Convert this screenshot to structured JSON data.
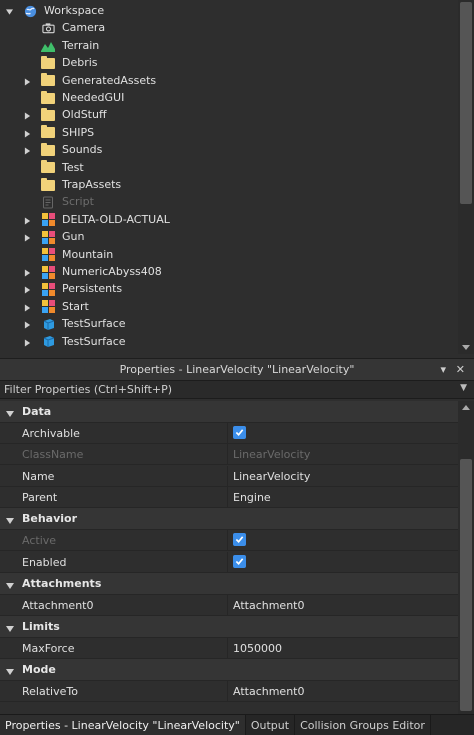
{
  "explorer": {
    "items": [
      {
        "label": "Workspace",
        "icon": "globe-icon",
        "arrow": "down",
        "level": 0,
        "dim": false
      },
      {
        "label": "Camera",
        "icon": "camera-icon",
        "arrow": "",
        "level": 1,
        "dim": false
      },
      {
        "label": "Terrain",
        "icon": "terrain-icon",
        "arrow": "",
        "level": 1,
        "dim": false
      },
      {
        "label": "Debris",
        "icon": "folder-icon",
        "arrow": "",
        "level": 1,
        "dim": false
      },
      {
        "label": "GeneratedAssets",
        "icon": "folder-icon",
        "arrow": "right",
        "level": 1,
        "dim": false
      },
      {
        "label": "NeededGUI",
        "icon": "folder-icon",
        "arrow": "",
        "level": 1,
        "dim": false
      },
      {
        "label": "OldStuff",
        "icon": "folder-icon",
        "arrow": "right",
        "level": 1,
        "dim": false
      },
      {
        "label": "SHIPS",
        "icon": "folder-icon",
        "arrow": "right",
        "level": 1,
        "dim": false
      },
      {
        "label": "Sounds",
        "icon": "folder-icon",
        "arrow": "right",
        "level": 1,
        "dim": false
      },
      {
        "label": "Test",
        "icon": "folder-icon",
        "arrow": "",
        "level": 1,
        "dim": false
      },
      {
        "label": "TrapAssets",
        "icon": "folder-icon",
        "arrow": "",
        "level": 1,
        "dim": false
      },
      {
        "label": "Script",
        "icon": "script-icon",
        "arrow": "",
        "level": 1,
        "dim": true
      },
      {
        "label": "DELTA-OLD-ACTUAL",
        "icon": "model-icon",
        "arrow": "right",
        "level": 1,
        "dim": false
      },
      {
        "label": "Gun",
        "icon": "model-icon",
        "arrow": "right",
        "level": 1,
        "dim": false
      },
      {
        "label": "Mountain",
        "icon": "model-icon",
        "arrow": "",
        "level": 1,
        "dim": false
      },
      {
        "label": "NumericAbyss408",
        "icon": "model-icon",
        "arrow": "right",
        "level": 1,
        "dim": false
      },
      {
        "label": "Persistents",
        "icon": "model-icon",
        "arrow": "right",
        "level": 1,
        "dim": false
      },
      {
        "label": "Start",
        "icon": "model-icon",
        "arrow": "right",
        "level": 1,
        "dim": false
      },
      {
        "label": "TestSurface",
        "icon": "part-icon",
        "arrow": "right",
        "level": 1,
        "dim": false
      },
      {
        "label": "TestSurface",
        "icon": "part-icon",
        "arrow": "right",
        "level": 1,
        "dim": false
      }
    ]
  },
  "properties": {
    "title": "Properties - LinearVelocity \"LinearVelocity\"",
    "filter_placeholder": "Filter Properties (Ctrl+Shift+P)",
    "sections": [
      {
        "name": "Data",
        "props": [
          {
            "name": "Archivable",
            "type": "bool",
            "value": true,
            "dim": false
          },
          {
            "name": "ClassName",
            "type": "text",
            "value": "LinearVelocity",
            "dim": true
          },
          {
            "name": "Name",
            "type": "text",
            "value": "LinearVelocity",
            "dim": false
          },
          {
            "name": "Parent",
            "type": "text",
            "value": "Engine",
            "dim": false
          }
        ]
      },
      {
        "name": "Behavior",
        "props": [
          {
            "name": "Active",
            "type": "bool",
            "value": true,
            "dim": true
          },
          {
            "name": "Enabled",
            "type": "bool",
            "value": true,
            "dim": false
          }
        ]
      },
      {
        "name": "Attachments",
        "props": [
          {
            "name": "Attachment0",
            "type": "text",
            "value": "Attachment0",
            "dim": false
          }
        ]
      },
      {
        "name": "Limits",
        "props": [
          {
            "name": "MaxForce",
            "type": "text",
            "value": "1050000",
            "dim": false
          }
        ]
      },
      {
        "name": "Mode",
        "props": [
          {
            "name": "RelativeTo",
            "type": "text",
            "value": "Attachment0",
            "dim": false
          }
        ]
      }
    ]
  },
  "tabs": [
    {
      "label": "Properties - LinearVelocity \"LinearVelocity\"",
      "active": true
    },
    {
      "label": "Output",
      "active": false
    },
    {
      "label": "Collision Groups Editor",
      "active": false
    }
  ],
  "colors": {
    "checkbox": "#3b8eea",
    "folder": "#f1d27a",
    "terrain": "#3fbf6a",
    "part": "#2e9ae0"
  }
}
